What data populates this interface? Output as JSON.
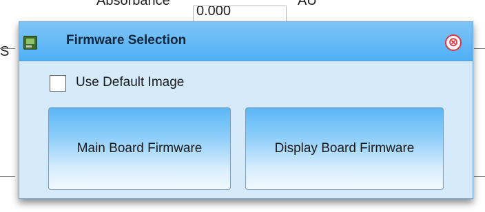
{
  "background": {
    "label_text": "Absorbance",
    "input_value": "0.000",
    "unit_text": "AU",
    "side_text": "S"
  },
  "dialog": {
    "title": "Firmware Selection",
    "icon": "firmware-board-icon",
    "close_icon": "close-circle-icon",
    "close_glyph": "⊗",
    "use_default": {
      "label": "Use Default Image",
      "checked": false
    },
    "buttons": {
      "main_board": "Main Board Firmware",
      "display_board": "Display Board Firmware"
    }
  },
  "colors": {
    "titlebar": "#4eb0f5",
    "dialog_bg": "#d5eafb",
    "close": "#e0343f"
  }
}
